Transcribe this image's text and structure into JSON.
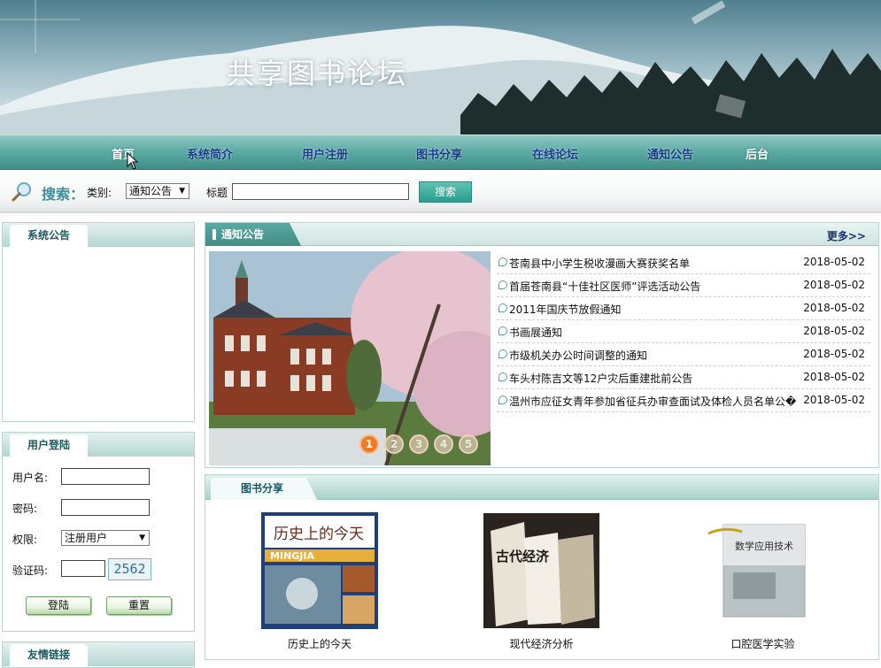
{
  "site": {
    "title": "共享图书论坛"
  },
  "nav": [
    "首页",
    "系统简介",
    "用户注册",
    "图书分享",
    "在线论坛",
    "通知公告",
    "后台"
  ],
  "search": {
    "title": "搜索：",
    "category_label": "类别:",
    "category_value": "通知公告",
    "title_label": "标题",
    "title_value": "",
    "button": "搜索"
  },
  "system_notice": {
    "heading": "系统公告"
  },
  "login": {
    "heading": "用户登陆",
    "username_label": "用户名:",
    "password_label": "密码:",
    "role_label": "权限:",
    "role_value": "注册用户",
    "captcha_label": "验证码:",
    "captcha_value": "2562",
    "login_button": "登陆",
    "reset_button": "重置"
  },
  "friend_links": {
    "heading": "友情链接"
  },
  "notices": {
    "heading": "通知公告",
    "more": "更多>>",
    "carousel_pages": [
      "1",
      "2",
      "3",
      "4",
      "5"
    ],
    "carousel_active": 1,
    "items": [
      {
        "title": "苍南县中小学生税收漫画大赛获奖名单",
        "date": "2018-05-02"
      },
      {
        "title": "首届苍南县“十佳社区医师”评选活动公告",
        "date": "2018-05-02"
      },
      {
        "title": "2011年国庆节放假通知",
        "date": "2018-05-02"
      },
      {
        "title": "书画展通知",
        "date": "2018-05-02"
      },
      {
        "title": "市级机关办公时间调整的通知",
        "date": "2018-05-02"
      },
      {
        "title": "车头村陈吉文等12户灾后重建批前公告",
        "date": "2018-05-02"
      },
      {
        "title": "温州市应征女青年参加省征兵办审查面试及体检人员名单公�",
        "date": "2018-05-02"
      }
    ]
  },
  "books": {
    "heading": "图书分享",
    "items": [
      {
        "title": "历史上的今天",
        "cover_text": "历史上的今天",
        "cover_sub": "MINGJIA"
      },
      {
        "title": "现代经济分析",
        "cover_text": "古代经济"
      },
      {
        "title": "口腔医学实验",
        "cover_text": "数学应用技术"
      }
    ]
  },
  "colors": {
    "accent": "#3f8f88",
    "nav_text": "#1a3a8a",
    "active_dot": "#f07b20"
  }
}
